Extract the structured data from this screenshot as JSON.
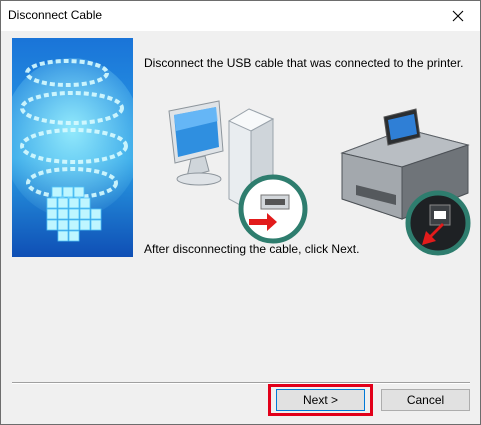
{
  "window": {
    "title": "Disconnect Cable"
  },
  "content": {
    "instruction": "Disconnect the USB cable that was connected to the printer.",
    "after_text": "After disconnecting the cable, click Next."
  },
  "buttons": {
    "next_label": "Next >",
    "cancel_label": "Cancel"
  },
  "colors": {
    "highlight": "#e2001a",
    "side_art_background": "#1e6fd0",
    "dialog_background": "#f0f0f0"
  },
  "icons": {
    "close": "close-icon",
    "computer": "computer-usb-illustration",
    "printer": "printer-usb-illustration",
    "side_art": "spiral-cubes-art"
  }
}
